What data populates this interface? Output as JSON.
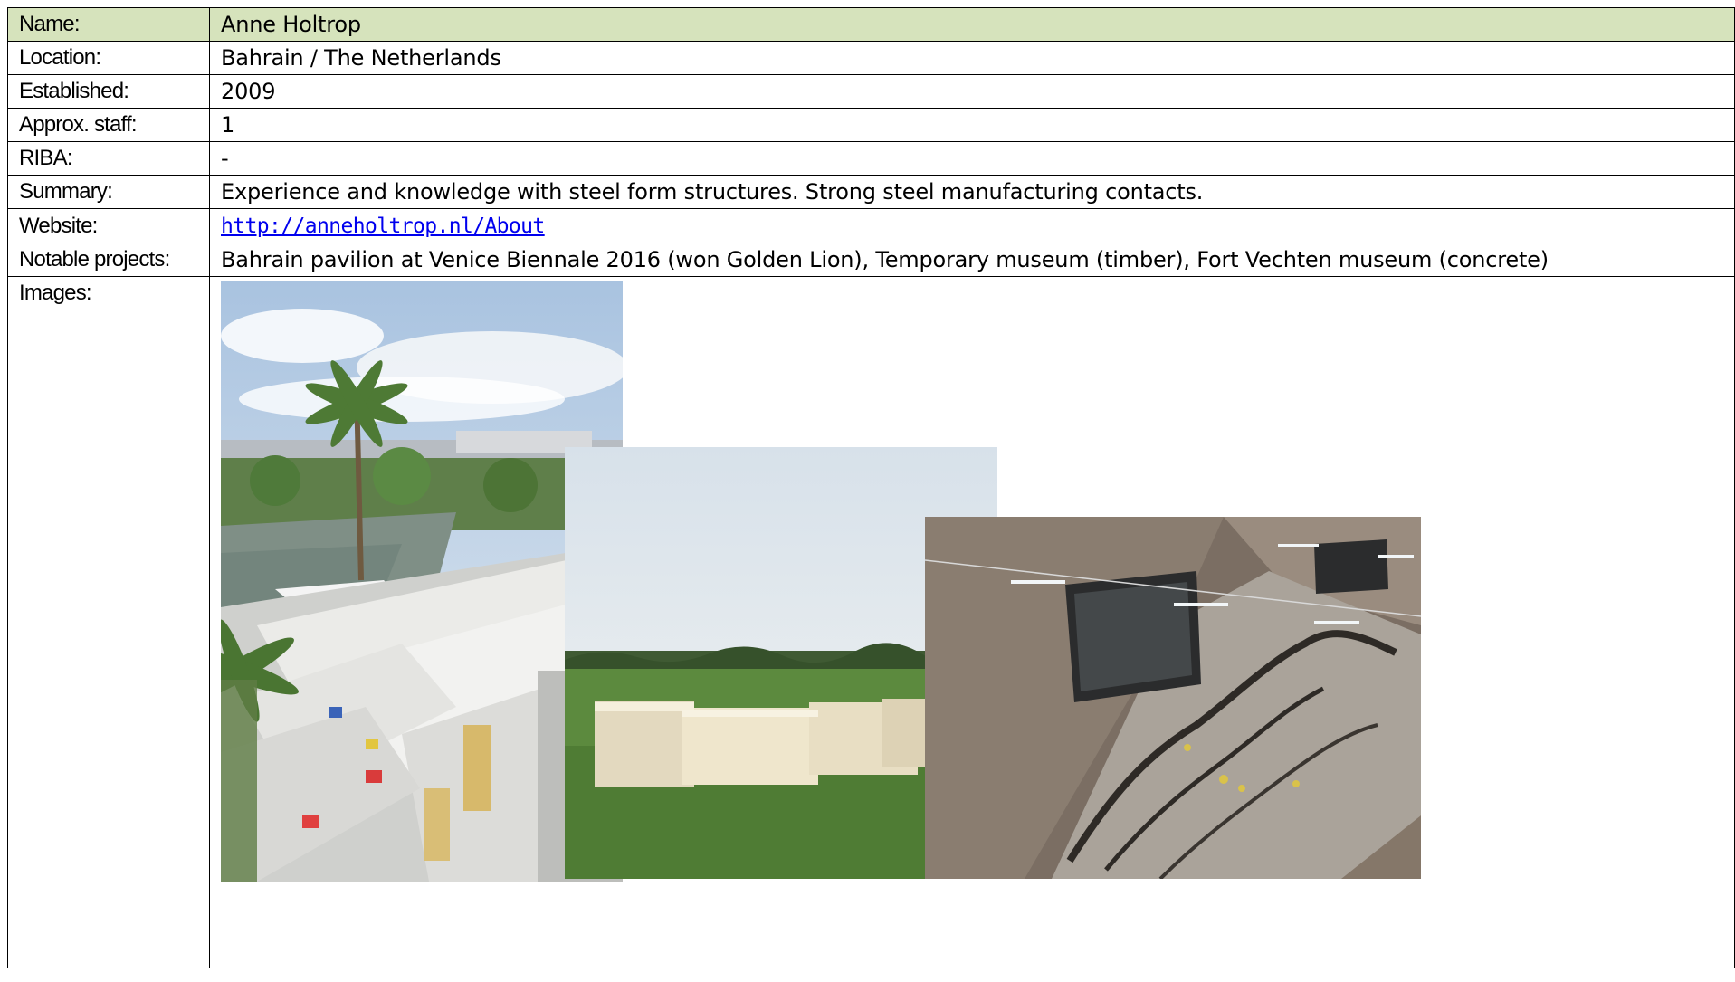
{
  "rows": [
    {
      "label": "Name:",
      "value": "Anne Holtrop"
    },
    {
      "label": "Location:",
      "value": "Bahrain / The Netherlands"
    },
    {
      "label": "Established:",
      "value": "2009"
    },
    {
      "label": "Approx. staff:",
      "value": "1"
    },
    {
      "label": "RIBA:",
      "value": "-"
    },
    {
      "label": "Summary:",
      "value": "Experience and knowledge with steel form structures. Strong steel manufacturing contacts."
    },
    {
      "label": "Website:",
      "value": "http://anneholtrop.nl/About"
    },
    {
      "label": "Notable projects:",
      "value": "Bahrain pavilion at Venice Biennale 2016 (won Golden Lion), Temporary museum (timber), Fort Vechten museum (concrete)"
    },
    {
      "label": "Images:",
      "value": ""
    }
  ],
  "colors": {
    "header_bg": "#d6e3bc",
    "link": "#0000ee",
    "border": "#000000"
  }
}
